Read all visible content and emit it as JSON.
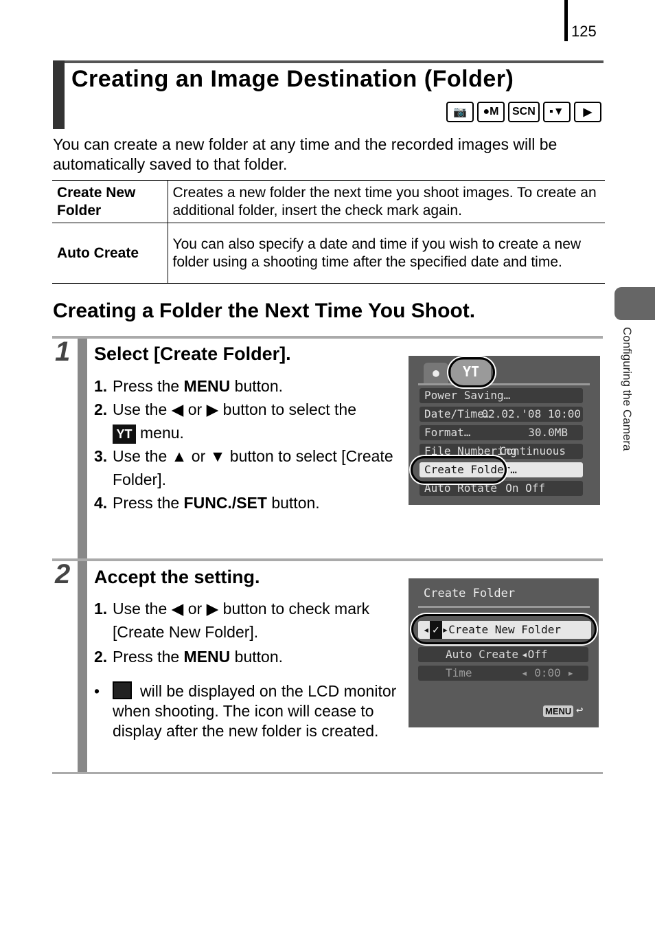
{
  "page": {
    "number": "125",
    "side_tab": "Configuring the Camera"
  },
  "title": "Creating an Image Destination (Folder)",
  "modes": [
    "camera-icon",
    "camera-m-icon",
    "SCN",
    "movie-icon",
    "playback-icon"
  ],
  "intro": "You can create a new folder at any time and the recorded images will be automatically saved to that folder.",
  "table": [
    {
      "term": "Create New Folder",
      "desc": "Creates a new folder the next time you shoot images. To create an additional folder, insert the check mark again."
    },
    {
      "term": "Auto Create",
      "desc": "You can also specify a date and time if you wish to create a new folder using a shooting time after the specified date and time."
    }
  ],
  "section": "Creating a Folder the Next Time You Shoot.",
  "step1": {
    "num": "1",
    "heading": "Select [Create Folder].",
    "items": [
      {
        "n": "1.",
        "pre": "Press the ",
        "b": "MENU",
        "post": " button."
      },
      {
        "n": "2.",
        "text": "Use the ◀ or ▶ button to select the",
        "icon": "ΥΤ",
        "after": "menu."
      },
      {
        "n": "3.",
        "text": "Use the ▲ or ▼ button to select [Create Folder]."
      },
      {
        "n": "4.",
        "pre": "Press the ",
        "b": "FUNC./SET",
        "post": " button."
      }
    ],
    "lcd": {
      "rows": [
        {
          "label": "Power Saving…",
          "value": ""
        },
        {
          "label": "Date/Time…",
          "value": "02.02.'08 10:00"
        },
        {
          "label": "Format…",
          "value": "30.0MB"
        },
        {
          "label": "File Numbering",
          "value": "Continuous"
        },
        {
          "label": "Create Folder…",
          "value": ""
        },
        {
          "label": "Auto Rotate",
          "value": "On Off"
        }
      ]
    }
  },
  "step2": {
    "num": "2",
    "heading": "Accept the setting.",
    "items": [
      {
        "n": "1.",
        "text": "Use the ◀ or ▶ button to check mark [Create New Folder]."
      },
      {
        "n": "2.",
        "pre": "Press the ",
        "b": "MENU",
        "post": " button."
      }
    ],
    "bullet": "will be displayed on the LCD monitor when shooting. The icon will cease to display after the new folder is created.",
    "lcd": {
      "title": "Create Folder",
      "rows": [
        {
          "label": "Create New Folder",
          "value": "✓"
        },
        {
          "label": "Auto Create",
          "value": "Off"
        },
        {
          "label": "Time",
          "value": "0:00"
        }
      ],
      "menu": "MENU"
    }
  }
}
